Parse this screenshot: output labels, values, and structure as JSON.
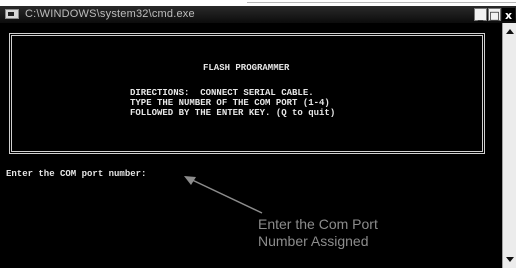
{
  "window": {
    "title": "C:\\WINDOWS\\system32\\cmd.exe",
    "minimize_label": "_",
    "restore_label": "□",
    "close_label": "x"
  },
  "console": {
    "banner_title": "FLASH PROGRAMMER",
    "directions_line1": "DIRECTIONS:  CONNECT SERIAL CABLE.",
    "directions_line2": "TYPE THE NUMBER OF THE COM PORT (1-4)",
    "directions_line3": "FOLLOWED BY THE ENTER KEY. (Q to quit)",
    "prompt": "Enter the COM port number:"
  },
  "annotation": {
    "line1": "Enter the Com Port",
    "line2": "Number Assigned"
  },
  "icons": [
    "console-app-icon",
    "scroll-up-arrow-icon",
    "scroll-down-arrow-icon",
    "annotation-arrow-icon"
  ],
  "colors": {
    "console_background": "#000000",
    "console_text": "#e6e6e6",
    "annotation_text": "#8c8c8c"
  }
}
